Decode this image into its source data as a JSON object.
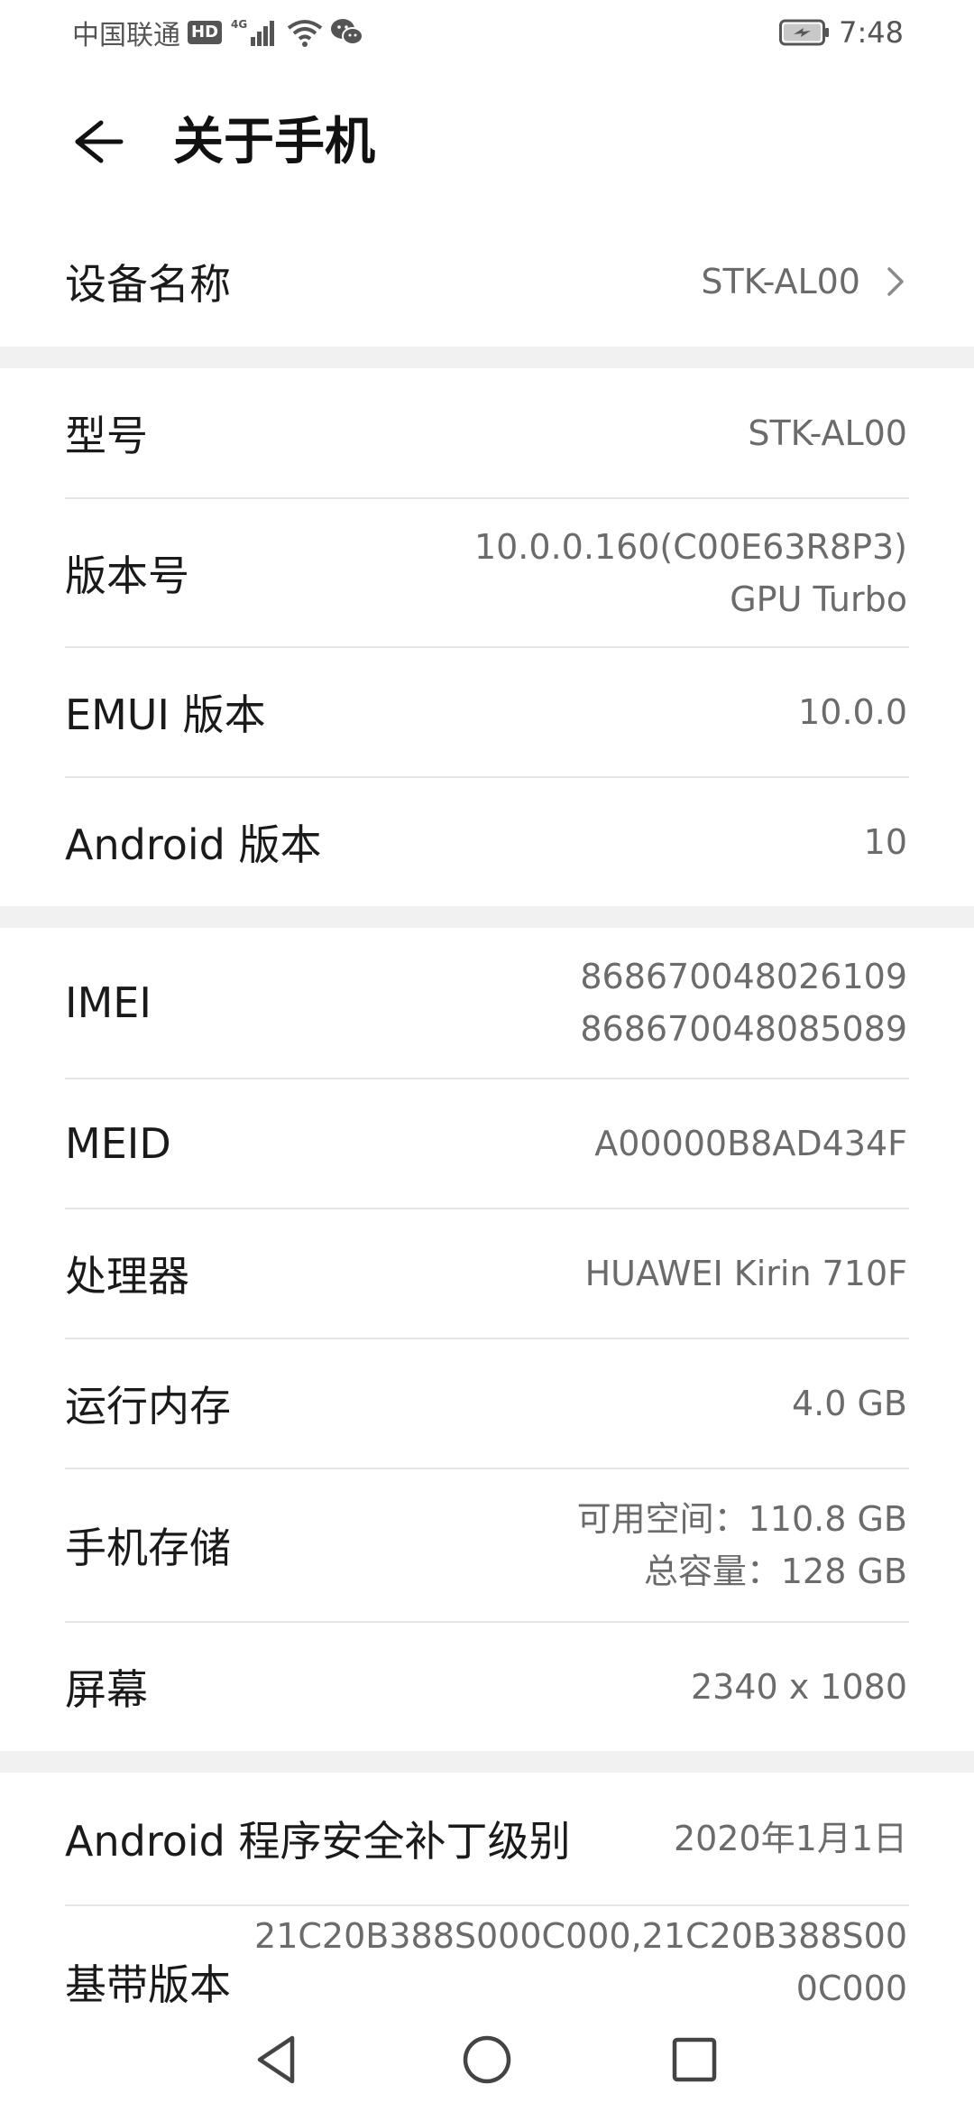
{
  "status_bar": {
    "carrier": "中国联通",
    "hd": "HD",
    "network": "4G",
    "time": "7:48"
  },
  "header": {
    "title": "关于手机"
  },
  "rows": {
    "device_name": {
      "label": "设备名称",
      "value": "STK-AL00"
    },
    "model": {
      "label": "型号",
      "value": "STK-AL00"
    },
    "build_number": {
      "label": "版本号",
      "value_line1": "10.0.0.160(C00E63R8P3)",
      "value_line2": "GPU Turbo"
    },
    "emui_version": {
      "label": "EMUI 版本",
      "value": "10.0.0"
    },
    "android_version": {
      "label": "Android 版本",
      "value": "10"
    },
    "imei": {
      "label": "IMEI",
      "value_line1": "868670048026109",
      "value_line2": "868670048085089"
    },
    "meid": {
      "label": "MEID",
      "value": "A00000B8AD434F"
    },
    "processor": {
      "label": "处理器",
      "value": "HUAWEI Kirin 710F"
    },
    "ram": {
      "label": "运行内存",
      "value": "4.0 GB"
    },
    "storage": {
      "label": "手机存储",
      "value_line1": "可用空间：110.8  GB",
      "value_line2": "总容量：128  GB"
    },
    "screen": {
      "label": "屏幕",
      "value": "2340 x 1080"
    },
    "security_patch": {
      "label": "Android 程序安全补丁级别",
      "value": "2020年1月1日"
    },
    "baseband": {
      "label": "基带版本",
      "value_line1": "21C20B388S000C000,21C20B388S00",
      "value_line2": "0C000"
    }
  },
  "nav_bar": {
    "back": "back-icon",
    "home": "home-icon",
    "recents": "recents-icon"
  },
  "colors": {
    "background": "#ffffff",
    "section_gap": "#f1f1f1",
    "label": "#1a1a1a",
    "value": "#6b6b6b",
    "divider": "#e6e6e6"
  }
}
